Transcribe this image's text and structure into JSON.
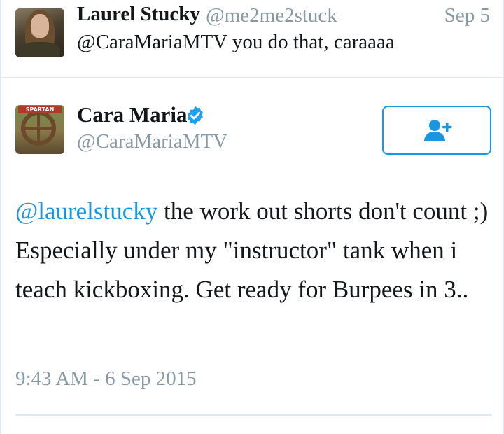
{
  "reply_tweet": {
    "name": "Laurel Stucky",
    "handle": "@me2me2stuck",
    "date": "Sep 5",
    "text": "@CaraMariaMTV you do that, caraaaa"
  },
  "main_tweet": {
    "name": "Cara Maria",
    "verified_icon": "verified-badge-icon",
    "handle": "@CaraMariaMTV",
    "follow_icon": "add-user-icon",
    "mention": "@laurelstucky",
    "text": " the work out shorts don't count ;) Especially under my \"instructor\" tank when i teach kickboxing. Get ready for Burpees in 3..",
    "timestamp": "9:43 AM - 6 Sep 2015",
    "avatar_banner": "SPARTAN"
  },
  "colors": {
    "accent": "#1b95e0",
    "muted": "#8899a6",
    "text": "#14171a",
    "border": "#e1e8ed"
  }
}
